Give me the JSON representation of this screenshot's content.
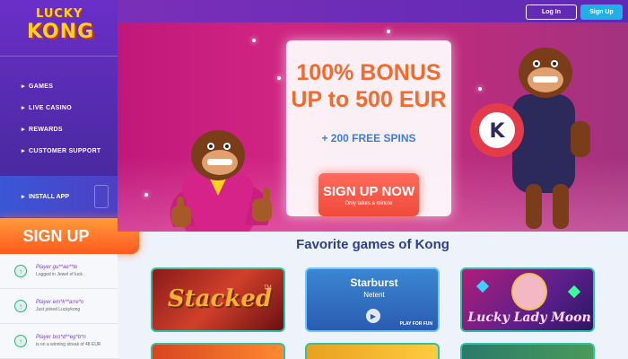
{
  "brand": {
    "logo_line1": "LUCKY",
    "logo_line2": "KONG"
  },
  "header": {
    "login_label": "Log In",
    "signup_label": "Sign Up"
  },
  "sidebar": {
    "items": [
      {
        "label": "GAMES"
      },
      {
        "label": "LIVE CASINO"
      },
      {
        "label": "REWARDS"
      },
      {
        "label": "CUSTOMER SUPPORT"
      }
    ],
    "install_label": "INSTALL APP",
    "signup_label": "SIGN UP"
  },
  "feed": [
    {
      "name": "Player gu**ae**te",
      "detail": "Logged in Jewel of luck"
    },
    {
      "name": "Player em*k**arre*o",
      "detail": "Just joined Luckykong"
    },
    {
      "name": "Player bro*d**eg*b*n",
      "detail": "is on a winning streak of 48 EUR"
    }
  ],
  "hero": {
    "line1": "100% BONUS",
    "line2": "UP to 500 EUR",
    "spins": "+ 200 FREE SPINS",
    "cta_label": "SIGN UP NOW",
    "cta_sub": "Only takes a minute"
  },
  "favorites": {
    "title": "Favorite games of Kong",
    "games": [
      {
        "title": "Stacked",
        "mark": "TM"
      },
      {
        "title": "Starburst",
        "provider": "Netent",
        "play_label": "PLAY FOR FUN"
      },
      {
        "title": "Lucky Lady Moon"
      }
    ]
  },
  "colors": {
    "accent_orange": "#f26a2e",
    "accent_blue": "#1fb0e8",
    "sidebar_purple": "#4b2aa3",
    "title_navy": "#2f3f8c"
  }
}
